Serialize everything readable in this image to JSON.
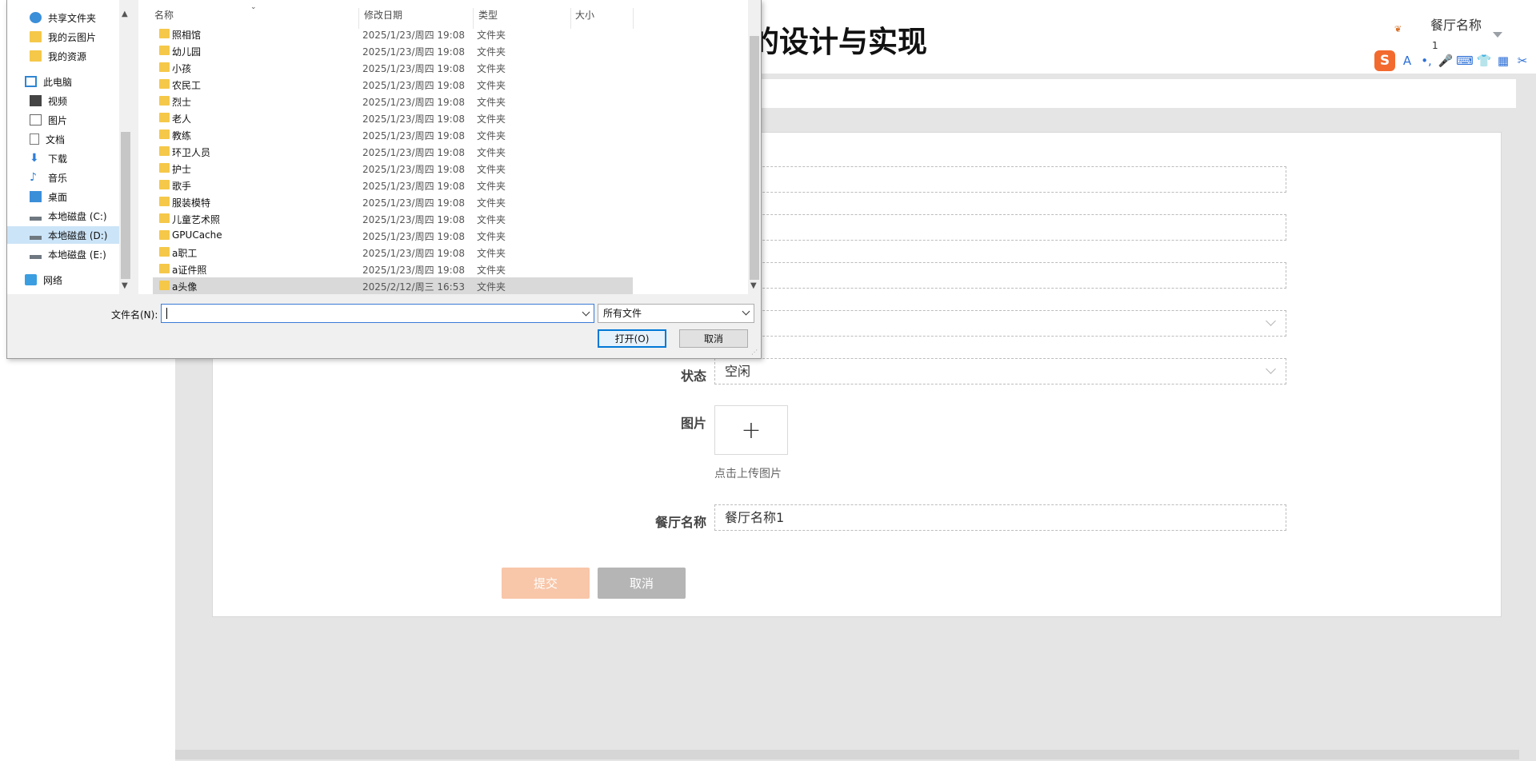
{
  "app": {
    "title": "的设计与实现",
    "user_name": "餐厅名称",
    "user_sub": "1"
  },
  "form": {
    "status_label": "状态",
    "status_value": "空闲",
    "image_label": "图片",
    "upload_plus": "+",
    "upload_hint": "点击上传图片",
    "restaurant_label": "餐厅名称",
    "restaurant_value": "餐厅名称1",
    "submit_label": "提交",
    "cancel_label": "取消"
  },
  "ime": {
    "logo": "S",
    "icons": [
      "A",
      "•,",
      "🎤",
      "⌨",
      "👕",
      "▦",
      "✂"
    ]
  },
  "dialog": {
    "nav_items": [
      {
        "label": "共享文件夹",
        "icon": "share-icon"
      },
      {
        "label": "我的云图片",
        "icon": "folder-icon"
      },
      {
        "label": "我的资源",
        "icon": "folder-icon"
      },
      {
        "label": "此电脑",
        "icon": "computer-icon"
      },
      {
        "label": "视频",
        "icon": "video-icon"
      },
      {
        "label": "图片",
        "icon": "picture-icon"
      },
      {
        "label": "文档",
        "icon": "document-icon"
      },
      {
        "label": "下载",
        "icon": "download-icon"
      },
      {
        "label": "音乐",
        "icon": "music-icon"
      },
      {
        "label": "桌面",
        "icon": "desktop-icon"
      },
      {
        "label": "本地磁盘 (C:)",
        "icon": "drive-icon"
      },
      {
        "label": "本地磁盘 (D:)",
        "icon": "drive-icon"
      },
      {
        "label": "本地磁盘 (E:)",
        "icon": "drive-icon"
      },
      {
        "label": "网络",
        "icon": "network-icon"
      }
    ],
    "columns": {
      "name": "名称",
      "date": "修改日期",
      "type": "类型",
      "size": "大小"
    },
    "files": [
      {
        "name": "照相馆",
        "date": "2025/1/23/周四 19:08",
        "type": "文件夹"
      },
      {
        "name": "幼儿园",
        "date": "2025/1/23/周四 19:08",
        "type": "文件夹"
      },
      {
        "name": "小孩",
        "date": "2025/1/23/周四 19:08",
        "type": "文件夹"
      },
      {
        "name": "农民工",
        "date": "2025/1/23/周四 19:08",
        "type": "文件夹"
      },
      {
        "name": "烈士",
        "date": "2025/1/23/周四 19:08",
        "type": "文件夹"
      },
      {
        "name": "老人",
        "date": "2025/1/23/周四 19:08",
        "type": "文件夹"
      },
      {
        "name": "教练",
        "date": "2025/1/23/周四 19:08",
        "type": "文件夹"
      },
      {
        "name": "环卫人员",
        "date": "2025/1/23/周四 19:08",
        "type": "文件夹"
      },
      {
        "name": "护士",
        "date": "2025/1/23/周四 19:08",
        "type": "文件夹"
      },
      {
        "name": "歌手",
        "date": "2025/1/23/周四 19:08",
        "type": "文件夹"
      },
      {
        "name": "服装模特",
        "date": "2025/1/23/周四 19:08",
        "type": "文件夹"
      },
      {
        "name": "儿童艺术照",
        "date": "2025/1/23/周四 19:08",
        "type": "文件夹"
      },
      {
        "name": "GPUCache",
        "date": "2025/1/23/周四 19:08",
        "type": "文件夹"
      },
      {
        "name": "a职工",
        "date": "2025/1/23/周四 19:08",
        "type": "文件夹"
      },
      {
        "name": "a证件照",
        "date": "2025/1/23/周四 19:08",
        "type": "文件夹"
      },
      {
        "name": "a头像",
        "date": "2025/2/12/周三 16:53",
        "type": "文件夹"
      }
    ],
    "filename_label": "文件名(N):",
    "filename_value": "",
    "filetype_value": "所有文件",
    "open_label": "打开(O)",
    "cancel_label": "取消"
  }
}
